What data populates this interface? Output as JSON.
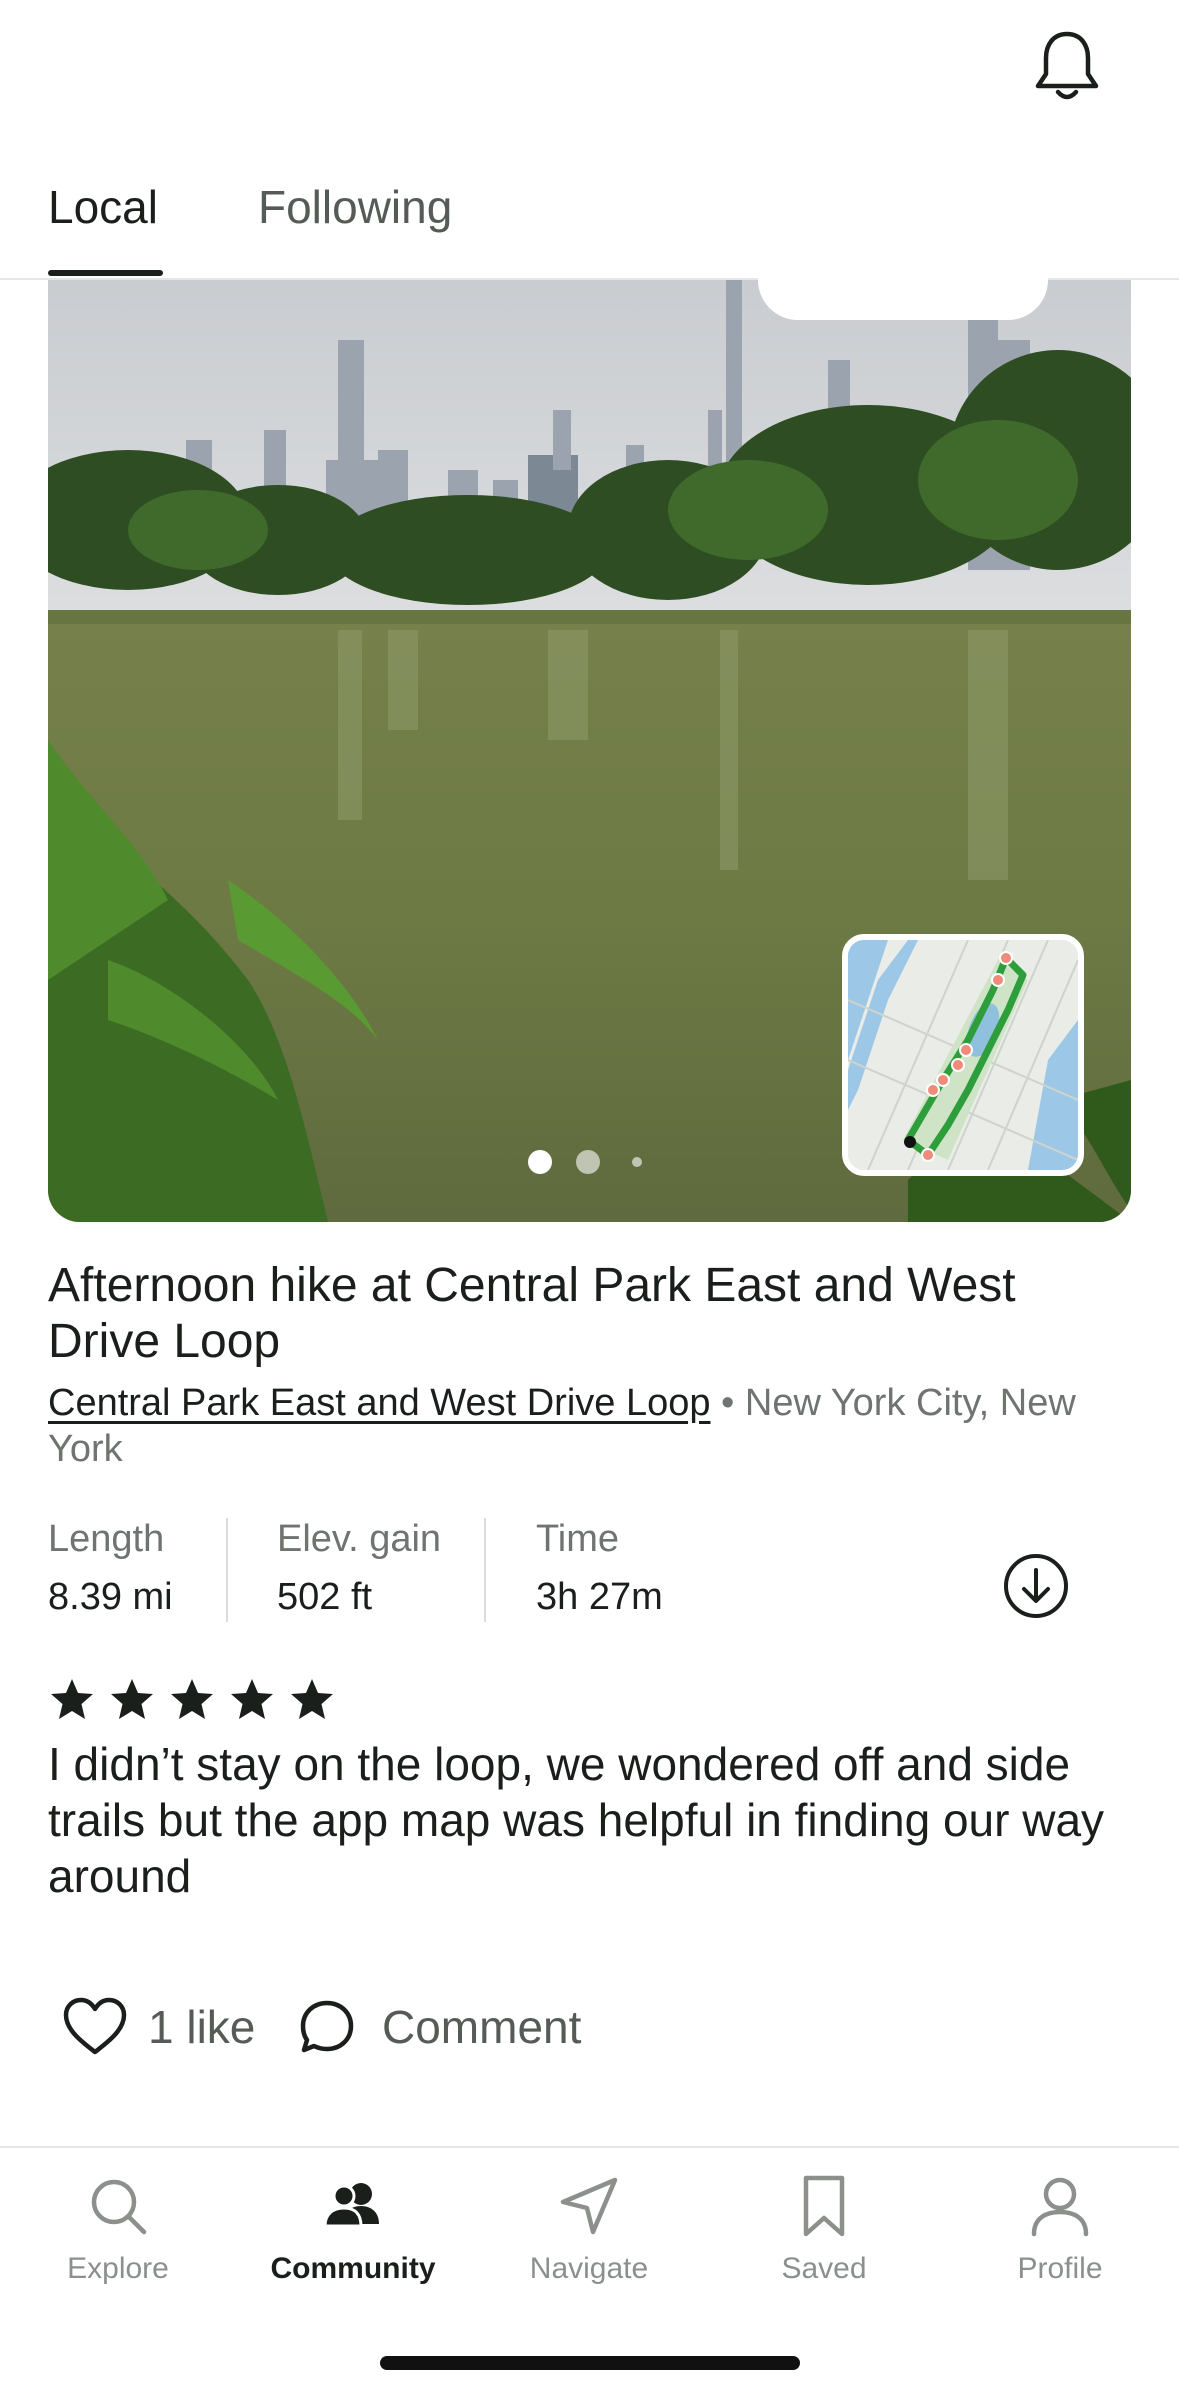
{
  "header": {
    "notifications_icon": "bell-icon",
    "tabs": [
      {
        "label": "Local",
        "active": true
      },
      {
        "label": "Following",
        "active": false
      }
    ]
  },
  "post": {
    "photo_count": 3,
    "active_photo_index": 0,
    "title": "Afternoon hike at Central Park East and West Drive Loop",
    "trail_name": "Central Park East and West Drive Loop",
    "location": " • New York City, New York",
    "stats": [
      {
        "label": "Length",
        "value": "8.39 mi"
      },
      {
        "label": "Elev. gain",
        "value": "502 ft"
      },
      {
        "label": "Time",
        "value": "3h 27m"
      }
    ],
    "rating": 5,
    "review": "I didn’t stay on the loop, we wondered off and side trails but the app map was helpful in finding our way around",
    "likes_label": "1 like",
    "comment_label": "Comment"
  },
  "bottom_nav": [
    {
      "label": "Explore",
      "icon": "search-icon",
      "active": false
    },
    {
      "label": "Community",
      "icon": "community-icon",
      "active": true
    },
    {
      "label": "Navigate",
      "icon": "navigate-icon",
      "active": false
    },
    {
      "label": "Saved",
      "icon": "bookmark-icon",
      "active": false
    },
    {
      "label": "Profile",
      "icon": "profile-icon",
      "active": false
    }
  ],
  "colors": {
    "text_primary": "#1b1f1c",
    "text_secondary": "#6f7470",
    "nav_inactive": "#8b908c",
    "route_green": "#2e9e3c"
  }
}
